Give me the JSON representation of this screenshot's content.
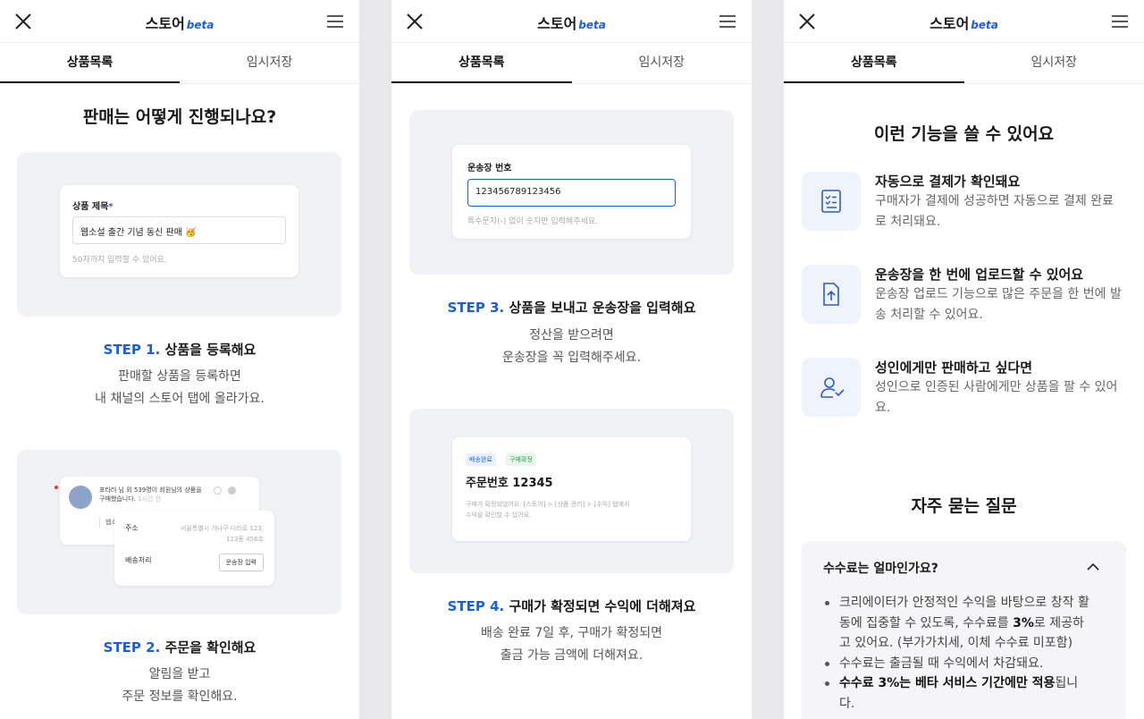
{
  "header": {
    "title": "스토어",
    "beta": "beta"
  },
  "tabs": [
    "상품목록",
    "임시저장"
  ],
  "panel1": {
    "heading": "판매는 어떻게 진행되나요?",
    "form": {
      "label": "상품 제목",
      "required": "*",
      "value": "웹소설 출간 기념 동신 판매 🥳",
      "hint": "50자까지 입력할 수 있어요."
    },
    "step1": {
      "num": "STEP 1.",
      "title": "상품을 등록해요",
      "desc1": "판매할 상품을 등록하면",
      "desc2": "내 채널의 스토어 탭에 올라가요."
    },
    "notif": {
      "text": "포타러 님 외 539명이 회원님의 상품을 구매했습니다.",
      "time": "1시간 전",
      "snippet": "웹소"
    },
    "order": {
      "addr_label": "주소",
      "addr_value1": "서울특별시 가나구 다라로 123,",
      "addr_value2": "123동 456호",
      "ship_label": "배송처리",
      "ship_button": "운송장 입력"
    },
    "step2": {
      "num": "STEP 2.",
      "title": "주문을 확인해요",
      "desc1": "알림을 받고",
      "desc2": "주문 정보를 확인해요."
    }
  },
  "panel2": {
    "tracking": {
      "label": "운송장 번호",
      "value": "123456789123456",
      "hint": "특수문자(-) 없이 숫자만 입력해주세요."
    },
    "step3": {
      "num": "STEP 3.",
      "title": "상품을 보내고 운송장을 입력해요",
      "desc1": "정산을 받으려면",
      "desc2": "운송장을 꼭 입력해주세요."
    },
    "orderCard": {
      "badge1": "배송완료",
      "badge2": "구매확정",
      "number": "주문번호 12345",
      "desc1": "구매가 확정되었어요. [스토어] > [상품 관리] > [수익] 탭에서",
      "desc2": "수익을 확인할 수 있어요."
    },
    "step4": {
      "num": "STEP 4.",
      "title": "구매가 확정되면 수익에 더해져요",
      "desc1": "배송 완료 7일 후, 구매가 확정되면",
      "desc2": "출금 가능 금액에 더해져요."
    }
  },
  "panel3": {
    "heading": "이런 기능을 쓸 수 있어요",
    "features": [
      {
        "icon": "checklist-icon",
        "title": "자동으로 결제가 확인돼요",
        "desc1": "구매자가 결제에 성공하면 자동으로 결제 완료",
        "desc2": "로 처리돼요."
      },
      {
        "icon": "upload-file-icon",
        "title": "운송장을 한 번에 업로드할 수 있어요",
        "desc1": "운송장 업로드 기능으로 많은 주문을 한 번에 발",
        "desc2": "송 처리할 수 있어요."
      },
      {
        "icon": "user-check-icon",
        "title": "성인에게만 판매하고 싶다면",
        "desc1": "성인으로 인증된 사람에게만 상품을 팔 수 있어",
        "desc2": "요."
      }
    ],
    "faqHeading": "자주 묻는 질문",
    "faq": {
      "question": "수수료는 얼마인가요?",
      "a1_pre": "크리에이터가 안정적인 수익을 바탕으로 창작 활동에 집중할 수 있도록, 수수료를 ",
      "a1_bold": "3%",
      "a1_post": "로 제공하고 있어요. (부가가치세, 이체 수수료 미포함)",
      "a2": "수수료는 출금될 때 수익에서 차감돼요.",
      "a3_bold": "수수료 3%는 베타 서비스 기간에만 적용",
      "a3_post": "됩니다."
    }
  },
  "colors": {
    "accent": "#1a5ee6",
    "card_bg": "#f1f2f6",
    "icon_bg": "#eef3fc"
  }
}
